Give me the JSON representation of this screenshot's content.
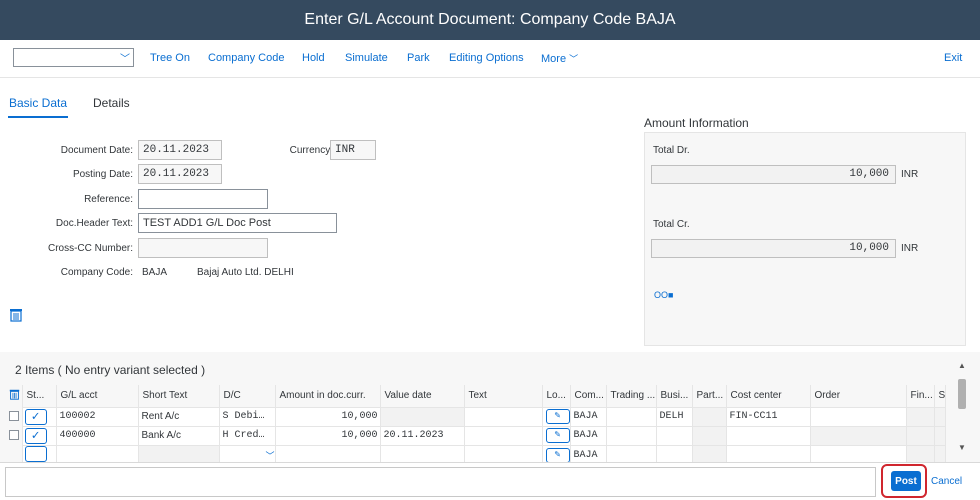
{
  "window": {
    "title": "Enter G/L Account Document: Company Code BAJA"
  },
  "toolbar": {
    "select_value": "",
    "buttons": [
      "Tree On",
      "Company Code",
      "Hold",
      "Simulate",
      "Park",
      "Editing Options"
    ],
    "more_label": "More",
    "exit_label": "Exit"
  },
  "tabs": [
    {
      "label": "Basic Data",
      "active": true
    },
    {
      "label": "Details",
      "active": false
    }
  ],
  "form": {
    "document_date": {
      "label": "Document Date:",
      "value": "20.11.2023"
    },
    "posting_date": {
      "label": "Posting Date:",
      "value": "20.11.2023"
    },
    "reference": {
      "label": "Reference:",
      "value": ""
    },
    "doc_header_text": {
      "label": "Doc.Header Text:",
      "value": "TEST ADD1 G/L Doc Post"
    },
    "cross_cc_number": {
      "label": "Cross-CC Number:",
      "value": ""
    },
    "company_code": {
      "label": "Company Code:",
      "value": "BAJA",
      "name": "Bajaj Auto Ltd. DELHI"
    },
    "currency": {
      "label": "Currency:",
      "value": "INR"
    }
  },
  "amount_info": {
    "title": "Amount Information",
    "total_dr": {
      "label": "Total Dr.",
      "value": "10,000",
      "currency": "INR"
    },
    "total_cr": {
      "label": "Total Cr.",
      "value": "10,000",
      "currency": "INR"
    },
    "status_indicator": "OO■"
  },
  "items": {
    "title": "2 Items ( No entry variant selected )",
    "columns": [
      "St...",
      "G/L acct",
      "Short Text",
      "D/C",
      "Amount in doc.curr.",
      "Value date",
      "Text",
      "Lo...",
      "Com...",
      "Trading ...",
      "Busi...",
      "Part...",
      "Cost center",
      "Order",
      "Fin...",
      "S"
    ],
    "rows": [
      {
        "gl_acct": "100002",
        "short_text": "Rent A/c",
        "dc": "S Debi…",
        "amount": "10,000",
        "value_date": "",
        "text": "",
        "company": "BAJA",
        "trading": "",
        "business": "DELH",
        "partner": "",
        "cost_center": "FIN-CC11",
        "order": ""
      },
      {
        "gl_acct": "400000",
        "short_text": "Bank A/c",
        "dc": "H Cred…",
        "amount": "10,000",
        "value_date": "20.11.2023",
        "text": "",
        "company": "BAJA",
        "trading": "",
        "business": "",
        "partner": "",
        "cost_center": "",
        "order": ""
      },
      {
        "gl_acct": "",
        "short_text": "",
        "dc": "",
        "amount": "",
        "value_date": "",
        "text": "",
        "company": "BAJA",
        "trading": "",
        "business": "",
        "partner": "",
        "cost_center": "",
        "order": ""
      }
    ]
  },
  "footer": {
    "message": "",
    "post_label": "Post",
    "cancel_label": "Cancel"
  }
}
